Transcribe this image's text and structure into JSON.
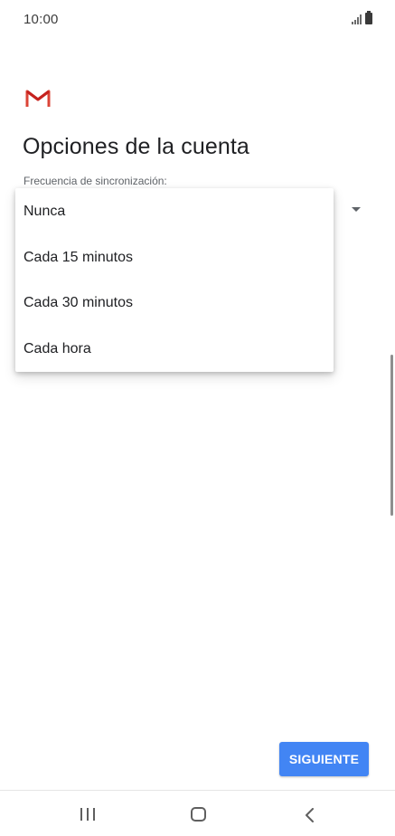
{
  "status_bar": {
    "time": "10:00"
  },
  "header": {
    "logo_icon": "gmail-m-icon",
    "title": "Opciones de la cuenta"
  },
  "sync_field": {
    "label": "Frecuencia de sincronización:"
  },
  "dropdown": {
    "options": [
      "Nunca",
      "Cada 15 minutos",
      "Cada 30 minutos",
      "Cada hora"
    ]
  },
  "footer": {
    "next_label": "SIGUIENTE"
  },
  "nav_bar": {
    "icons": [
      "recent-apps-icon",
      "home-icon",
      "back-icon"
    ]
  },
  "colors": {
    "accent": "#4285f4",
    "gmail_red": "#db4437",
    "text_primary": "#202124",
    "text_secondary": "#5f6368"
  }
}
